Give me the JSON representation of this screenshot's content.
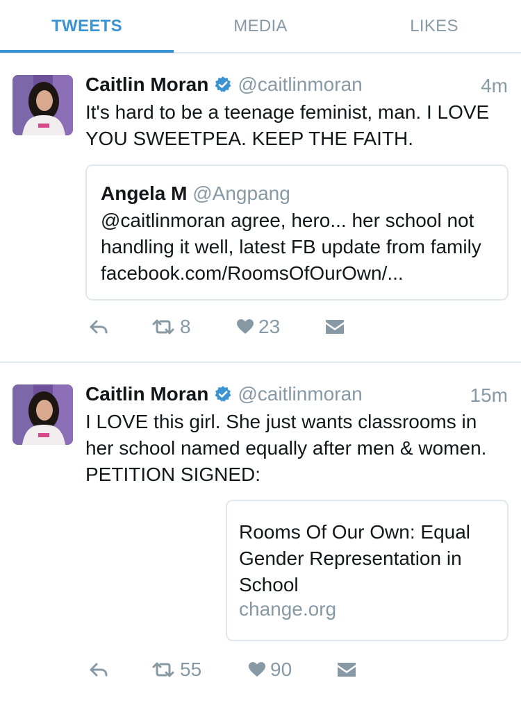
{
  "tabs": {
    "items": [
      {
        "label": "TWEETS",
        "active": true
      },
      {
        "label": "MEDIA",
        "active": false
      },
      {
        "label": "LIKES",
        "active": false
      }
    ]
  },
  "colors": {
    "accent": "#3a93d2",
    "muted": "#8899a6",
    "divider": "#e1e8ed",
    "text": "#14171a"
  },
  "tweets": [
    {
      "author_name": "Caitlin Moran",
      "verified": true,
      "handle": "@caitlinmoran",
      "time": "4m",
      "text": "It's hard to be a teenage feminist, man. I LOVE YOU SWEETPEA. KEEP THE FAITH.",
      "quoted": {
        "author_name": "Angela M",
        "handle": "@Angpang",
        "text": "@caitlinmoran agree, hero... her school not handling it well, latest FB update from family facebook.com/RoomsOfOurOwn/..."
      },
      "actions": {
        "reply_icon": "reply-icon",
        "retweet_count": "8",
        "like_count": "23",
        "dm_icon": "direct-message-icon"
      }
    },
    {
      "author_name": "Caitlin Moran",
      "verified": true,
      "handle": "@caitlinmoran",
      "time": "15m",
      "text": "I LOVE this girl. She just wants classrooms in her school named equally after men & women. PETITION SIGNED:",
      "link_card": {
        "title": "Rooms Of Our Own: Equal Gender Representation in School",
        "domain": "change.org"
      },
      "actions": {
        "reply_icon": "reply-icon",
        "retweet_count": "55",
        "like_count": "90",
        "dm_icon": "direct-message-icon"
      }
    }
  ]
}
